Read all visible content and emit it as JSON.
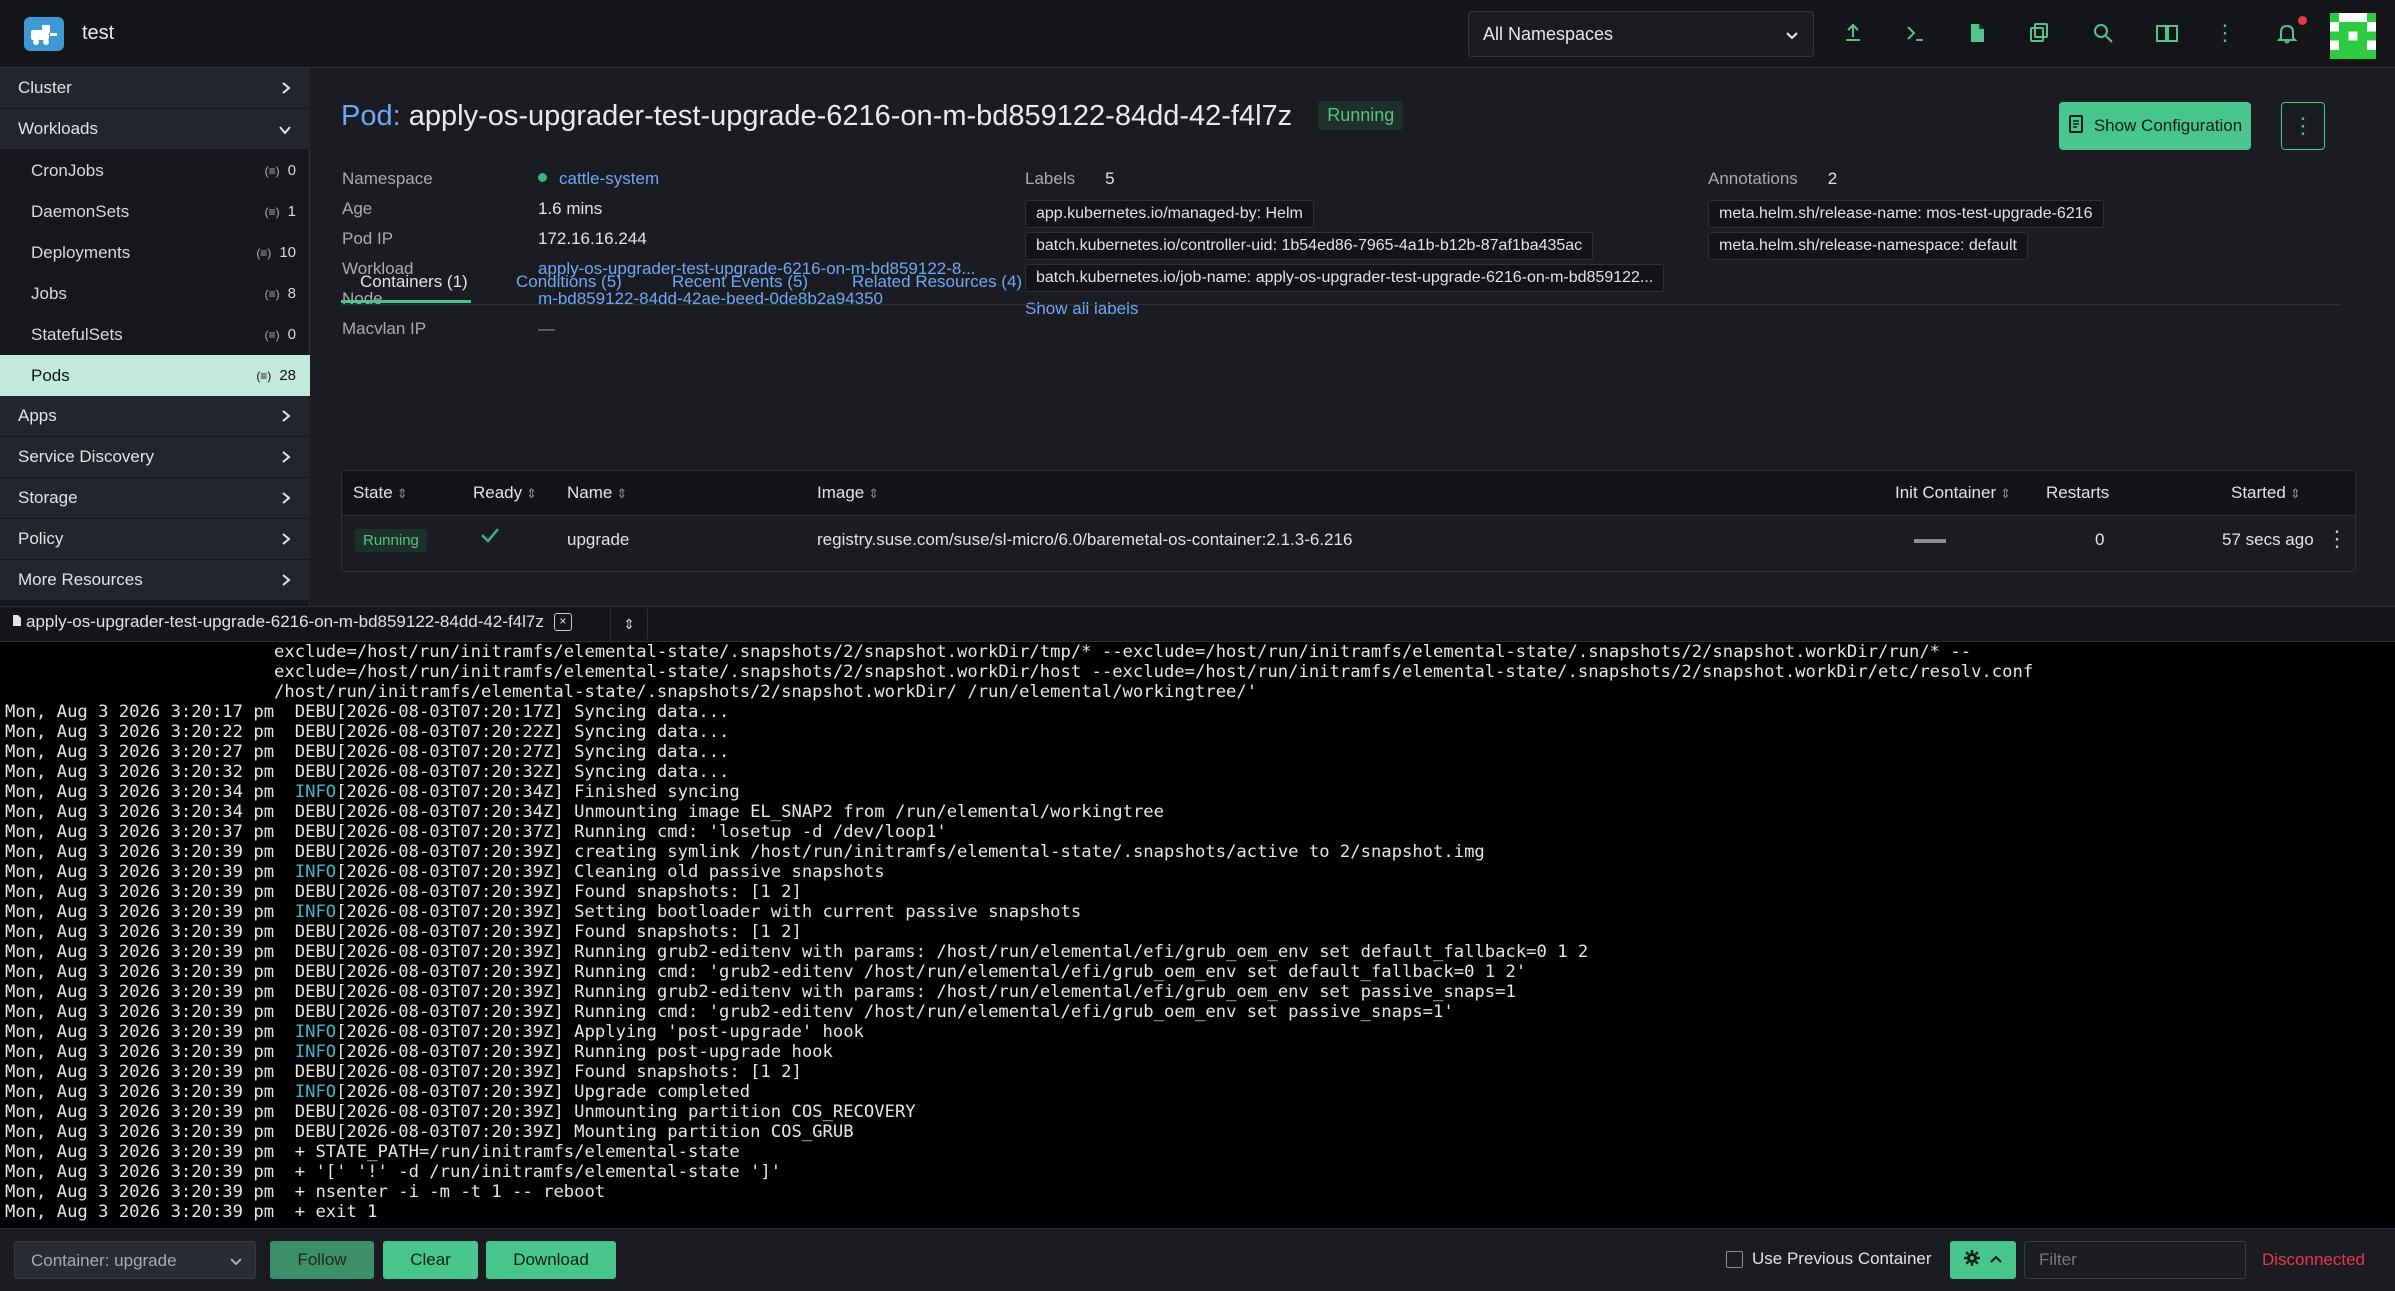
{
  "header": {
    "cluster_name": "test",
    "namespace_select": "All Namespaces",
    "icons": [
      "import-icon",
      "shell-icon",
      "file-icon",
      "copy-icon",
      "search-icon",
      "book-icon",
      "more-vertical-icon",
      "bell-icon"
    ]
  },
  "sidebar": {
    "groups": [
      {
        "label": "Cluster"
      },
      {
        "label": "Workloads"
      },
      {
        "label": "Apps"
      },
      {
        "label": "Service Discovery"
      },
      {
        "label": "Storage"
      },
      {
        "label": "Policy"
      },
      {
        "label": "More Resources"
      }
    ],
    "workload_items": [
      {
        "label": "CronJobs",
        "count": "0"
      },
      {
        "label": "DaemonSets",
        "count": "1"
      },
      {
        "label": "Deployments",
        "count": "10"
      },
      {
        "label": "Jobs",
        "count": "8"
      },
      {
        "label": "StatefulSets",
        "count": "0"
      },
      {
        "label": "Pods",
        "count": "28"
      }
    ]
  },
  "pod": {
    "kind": "Pod:",
    "name": "apply-os-upgrader-test-upgrade-6216-on-m-bd859122-84dd-42-f4l7z",
    "status": "Running",
    "show_config_label": "Show Configuration",
    "details": {
      "namespace_label": "Namespace",
      "namespace": "cattle-system",
      "age_label": "Age",
      "age": "1.6 mins",
      "pod_ip_label": "Pod IP",
      "pod_ip": "172.16.16.244",
      "workload_label": "Workload",
      "workload": "apply-os-upgrader-test-upgrade-6216-on-m-bd859122-8...",
      "node_label": "Node",
      "node": "m-bd859122-84dd-42ae-beed-0de8b2a94350",
      "macvlan_label": "Macvlan IP",
      "macvlan": "—"
    },
    "labels_title": "Labels",
    "labels_count": "5",
    "labels": [
      "app.kubernetes.io/managed-by: Helm",
      "batch.kubernetes.io/controller-uid: 1b54ed86-7965-4a1b-b12b-87af1ba435ac",
      "batch.kubernetes.io/job-name: apply-os-upgrader-test-upgrade-6216-on-m-bd859122..."
    ],
    "show_all_labels": "Show all labels",
    "annotations_title": "Annotations",
    "annotations_count": "2",
    "annotations": [
      "meta.helm.sh/release-name: mos-test-upgrade-6216",
      "meta.helm.sh/release-namespace: default"
    ]
  },
  "tabs": [
    {
      "label": "Containers (1)"
    },
    {
      "label": "Conditions (5)"
    },
    {
      "label": "Recent Events (5)"
    },
    {
      "label": "Related Resources (4)"
    }
  ],
  "containers_table": {
    "headers": {
      "state": "State",
      "ready": "Ready",
      "name": "Name",
      "image": "Image",
      "init": "Init Container",
      "restarts": "Restarts",
      "started": "Started"
    },
    "row": {
      "state": "Running",
      "name": "upgrade",
      "image": "registry.suse.com/suse/sl-micro/6.0/baremetal-os-container:2.1.3-6.216",
      "restarts": "0",
      "started": "57 secs ago"
    }
  },
  "terminal": {
    "tab_title": "apply-os-upgrader-test-upgrade-6216-on-m-bd859122-84dd-42-f4l7z",
    "lines": [
      {
        "time": "",
        "level": "",
        "stamp": "",
        "msg": "exclude=/host/run/initramfs/elemental-state/.snapshots/2/snapshot.workDir/tmp/* --exclude=/host/run/initramfs/elemental-state/.snapshots/2/snapshot.workDir/run/* --"
      },
      {
        "time": "",
        "level": "",
        "stamp": "",
        "msg": "exclude=/host/run/initramfs/elemental-state/.snapshots/2/snapshot.workDir/host --exclude=/host/run/initramfs/elemental-state/.snapshots/2/snapshot.workDir/etc/resolv.conf"
      },
      {
        "time": "",
        "level": "",
        "stamp": "",
        "msg": "/host/run/initramfs/elemental-state/.snapshots/2/snapshot.workDir/ /run/elemental/workingtree/'"
      },
      {
        "time": "Mon, Aug 3 2026 3:20:17 pm",
        "level": "DEBU",
        "stamp": "[2026-08-03T07:20:17Z]",
        "msg": "Syncing data..."
      },
      {
        "time": "Mon, Aug 3 2026 3:20:22 pm",
        "level": "DEBU",
        "stamp": "[2026-08-03T07:20:22Z]",
        "msg": "Syncing data..."
      },
      {
        "time": "Mon, Aug 3 2026 3:20:27 pm",
        "level": "DEBU",
        "stamp": "[2026-08-03T07:20:27Z]",
        "msg": "Syncing data..."
      },
      {
        "time": "Mon, Aug 3 2026 3:20:32 pm",
        "level": "DEBU",
        "stamp": "[2026-08-03T07:20:32Z]",
        "msg": "Syncing data..."
      },
      {
        "time": "Mon, Aug 3 2026 3:20:34 pm",
        "level": "INFO",
        "stamp": "[2026-08-03T07:20:34Z]",
        "msg": "Finished syncing"
      },
      {
        "time": "Mon, Aug 3 2026 3:20:34 pm",
        "level": "DEBU",
        "stamp": "[2026-08-03T07:20:34Z]",
        "msg": "Unmounting image EL_SNAP2 from /run/elemental/workingtree"
      },
      {
        "time": "Mon, Aug 3 2026 3:20:37 pm",
        "level": "DEBU",
        "stamp": "[2026-08-03T07:20:37Z]",
        "msg": "Running cmd: 'losetup -d /dev/loop1'"
      },
      {
        "time": "Mon, Aug 3 2026 3:20:39 pm",
        "level": "DEBU",
        "stamp": "[2026-08-03T07:20:39Z]",
        "msg": "creating symlink /host/run/initramfs/elemental-state/.snapshots/active to 2/snapshot.img"
      },
      {
        "time": "Mon, Aug 3 2026 3:20:39 pm",
        "level": "INFO",
        "stamp": "[2026-08-03T07:20:39Z]",
        "msg": "Cleaning old passive snapshots"
      },
      {
        "time": "Mon, Aug 3 2026 3:20:39 pm",
        "level": "DEBU",
        "stamp": "[2026-08-03T07:20:39Z]",
        "msg": "Found snapshots: [1 2]"
      },
      {
        "time": "Mon, Aug 3 2026 3:20:39 pm",
        "level": "INFO",
        "stamp": "[2026-08-03T07:20:39Z]",
        "msg": "Setting bootloader with current passive snapshots"
      },
      {
        "time": "Mon, Aug 3 2026 3:20:39 pm",
        "level": "DEBU",
        "stamp": "[2026-08-03T07:20:39Z]",
        "msg": "Found snapshots: [1 2]"
      },
      {
        "time": "Mon, Aug 3 2026 3:20:39 pm",
        "level": "DEBU",
        "stamp": "[2026-08-03T07:20:39Z]",
        "msg": "Running grub2-editenv with params: /host/run/elemental/efi/grub_oem_env set default_fallback=0 1 2"
      },
      {
        "time": "Mon, Aug 3 2026 3:20:39 pm",
        "level": "DEBU",
        "stamp": "[2026-08-03T07:20:39Z]",
        "msg": "Running cmd: 'grub2-editenv /host/run/elemental/efi/grub_oem_env set default_fallback=0 1 2'"
      },
      {
        "time": "Mon, Aug 3 2026 3:20:39 pm",
        "level": "DEBU",
        "stamp": "[2026-08-03T07:20:39Z]",
        "msg": "Running grub2-editenv with params: /host/run/elemental/efi/grub_oem_env set passive_snaps=1"
      },
      {
        "time": "Mon, Aug 3 2026 3:20:39 pm",
        "level": "DEBU",
        "stamp": "[2026-08-03T07:20:39Z]",
        "msg": "Running cmd: 'grub2-editenv /host/run/elemental/efi/grub_oem_env set passive_snaps=1'"
      },
      {
        "time": "Mon, Aug 3 2026 3:20:39 pm",
        "level": "INFO",
        "stamp": "[2026-08-03T07:20:39Z]",
        "msg": "Applying 'post-upgrade' hook"
      },
      {
        "time": "Mon, Aug 3 2026 3:20:39 pm",
        "level": "INFO",
        "stamp": "[2026-08-03T07:20:39Z]",
        "msg": "Running post-upgrade hook"
      },
      {
        "time": "Mon, Aug 3 2026 3:20:39 pm",
        "level": "DEBU",
        "stamp": "[2026-08-03T07:20:39Z]",
        "msg": "Found snapshots: [1 2]"
      },
      {
        "time": "Mon, Aug 3 2026 3:20:39 pm",
        "level": "INFO",
        "stamp": "[2026-08-03T07:20:39Z]",
        "msg": "Upgrade completed"
      },
      {
        "time": "Mon, Aug 3 2026 3:20:39 pm",
        "level": "DEBU",
        "stamp": "[2026-08-03T07:20:39Z]",
        "msg": "Unmounting partition COS_RECOVERY"
      },
      {
        "time": "Mon, Aug 3 2026 3:20:39 pm",
        "level": "DEBU",
        "stamp": "[2026-08-03T07:20:39Z]",
        "msg": "Mounting partition COS_GRUB"
      },
      {
        "time": "Mon, Aug 3 2026 3:20:39 pm",
        "level": "",
        "stamp": "",
        "msg": "+ STATE_PATH=/run/initramfs/elemental-state"
      },
      {
        "time": "Mon, Aug 3 2026 3:20:39 pm",
        "level": "",
        "stamp": "",
        "msg": "+ '[' '!' -d /run/initramfs/elemental-state ']'"
      },
      {
        "time": "Mon, Aug 3 2026 3:20:39 pm",
        "level": "",
        "stamp": "",
        "msg": "+ nsenter -i -m -t 1 -- reboot"
      },
      {
        "time": "Mon, Aug 3 2026 3:20:39 pm",
        "level": "",
        "stamp": "",
        "msg": "+ exit 1"
      }
    ]
  },
  "footer": {
    "container_select": "Container: upgrade",
    "follow": "Follow",
    "clear": "Clear",
    "download": "Download",
    "use_previous": "Use Previous Container",
    "filter_placeholder": "Filter",
    "connection_status": "Disconnected"
  },
  "colors": {
    "accent": "#49c68d",
    "link": "#6ea8f7",
    "error": "#e5394b",
    "info_level": "#3fb7c9"
  }
}
